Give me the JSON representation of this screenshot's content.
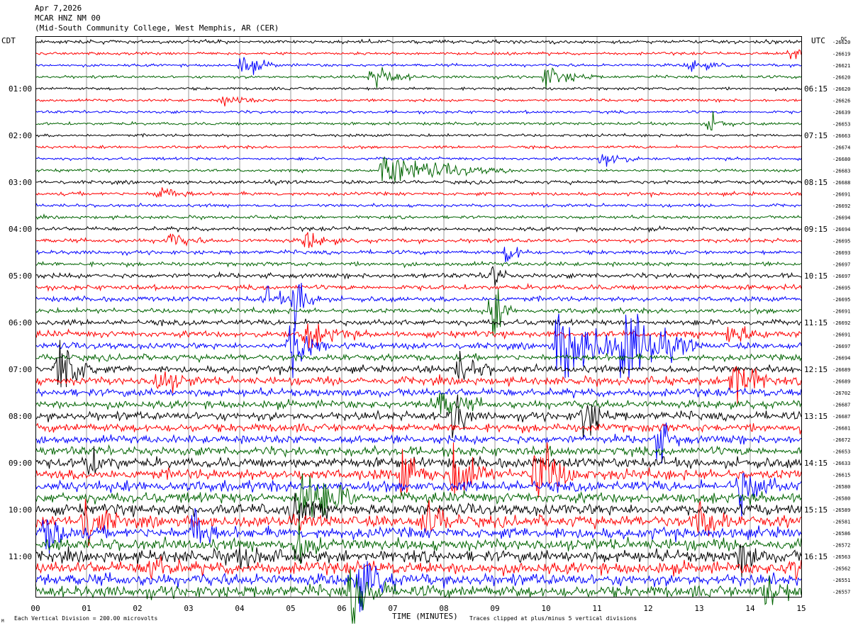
{
  "header": {
    "date": "Apr 7,2026",
    "station": "MCAR HNZ NM 00",
    "location": "(Mid-South Community College, West Memphis, AR (CER)"
  },
  "chart_data": {
    "type": "line",
    "title": "MCAR HNZ NM 00",
    "left_axis_label": "CDT",
    "right_axis_label": "UTC",
    "dc_label": "DC",
    "xlabel": "TIME (MINUTES)",
    "xlim": [
      0,
      15
    ],
    "x_ticks": [
      "00",
      "01",
      "02",
      "03",
      "04",
      "05",
      "06",
      "07",
      "08",
      "09",
      "10",
      "11",
      "12",
      "13",
      "14",
      "15"
    ],
    "left_time_labels": [
      {
        "row": 4,
        "label": "01:00"
      },
      {
        "row": 8,
        "label": "02:00"
      },
      {
        "row": 12,
        "label": "03:00"
      },
      {
        "row": 16,
        "label": "04:00"
      },
      {
        "row": 20,
        "label": "05:00"
      },
      {
        "row": 24,
        "label": "06:00"
      },
      {
        "row": 28,
        "label": "07:00"
      },
      {
        "row": 32,
        "label": "08:00"
      },
      {
        "row": 36,
        "label": "09:00"
      },
      {
        "row": 40,
        "label": "10:00"
      },
      {
        "row": 44,
        "label": "11:00"
      }
    ],
    "right_time_labels": [
      {
        "row": 4,
        "label": "06:15"
      },
      {
        "row": 8,
        "label": "07:15"
      },
      {
        "row": 12,
        "label": "08:15"
      },
      {
        "row": 16,
        "label": "09:15"
      },
      {
        "row": 20,
        "label": "10:15"
      },
      {
        "row": 24,
        "label": "11:15"
      },
      {
        "row": 28,
        "label": "12:15"
      },
      {
        "row": 32,
        "label": "13:15"
      },
      {
        "row": 36,
        "label": "14:15"
      },
      {
        "row": 40,
        "label": "15:15"
      },
      {
        "row": 44,
        "label": "16:15"
      }
    ],
    "dc_offsets": [
      -26620,
      -26619,
      -26621,
      -26620,
      -26620,
      -26626,
      -26639,
      -26653,
      -26663,
      -26674,
      -26680,
      -26683,
      -26688,
      -26691,
      -26692,
      -26694,
      -26694,
      -26695,
      -26693,
      -26697,
      -26697,
      -26695,
      -26695,
      -26691,
      -26692,
      -26691,
      -26697,
      -26694,
      -26689,
      -26689,
      -26702,
      -26687,
      -26687,
      -26681,
      -26672,
      -26653,
      -26633,
      -26615,
      -26580,
      -26580,
      -26589,
      -26581,
      -26586,
      -26572,
      -26563,
      -26562,
      -26551,
      -26557
    ],
    "trace_colors": [
      "#000000",
      "#ff0000",
      "#0000ff",
      "#006400"
    ],
    "num_traces": 48,
    "minutes_per_trace": 15,
    "noise_amplitude_by_row": [
      0.25,
      0.2,
      0.2,
      0.2,
      0.2,
      0.2,
      0.2,
      0.2,
      0.2,
      0.2,
      0.2,
      0.2,
      0.25,
      0.25,
      0.22,
      0.22,
      0.28,
      0.28,
      0.28,
      0.3,
      0.35,
      0.35,
      0.35,
      0.35,
      0.4,
      0.45,
      0.45,
      0.45,
      0.5,
      0.55,
      0.55,
      0.55,
      0.6,
      0.6,
      0.6,
      0.65,
      0.7,
      0.75,
      0.75,
      0.75,
      0.8,
      0.8,
      0.8,
      0.8,
      0.85,
      0.85,
      0.85,
      0.85
    ],
    "events": [
      {
        "row": 1,
        "t": 14.8,
        "amp": 0.6,
        "dur": 0.2
      },
      {
        "row": 2,
        "t": 4.05,
        "amp": 0.9,
        "dur": 0.3
      },
      {
        "row": 2,
        "t": 12.8,
        "amp": 0.6,
        "dur": 0.3
      },
      {
        "row": 3,
        "t": 6.6,
        "amp": 1.0,
        "dur": 0.35
      },
      {
        "row": 3,
        "t": 10.0,
        "amp": 0.9,
        "dur": 0.4
      },
      {
        "row": 5,
        "t": 3.7,
        "amp": 0.5,
        "dur": 0.3
      },
      {
        "row": 7,
        "t": 13.2,
        "amp": 0.9,
        "dur": 0.2
      },
      {
        "row": 10,
        "t": 11.1,
        "amp": 0.9,
        "dur": 0.3
      },
      {
        "row": 11,
        "t": 6.8,
        "amp": 1.3,
        "dur": 1.0
      },
      {
        "row": 13,
        "t": 2.4,
        "amp": 0.7,
        "dur": 0.3
      },
      {
        "row": 17,
        "t": 2.6,
        "amp": 0.7,
        "dur": 0.3
      },
      {
        "row": 17,
        "t": 5.3,
        "amp": 0.7,
        "dur": 0.3
      },
      {
        "row": 18,
        "t": 9.25,
        "amp": 1.0,
        "dur": 0.2
      },
      {
        "row": 20,
        "t": 8.9,
        "amp": 1.6,
        "dur": 0.15
      },
      {
        "row": 22,
        "t": 4.5,
        "amp": 0.8,
        "dur": 0.3
      },
      {
        "row": 23,
        "t": 8.95,
        "amp": 2.8,
        "dur": 0.15
      },
      {
        "row": 22,
        "t": 5.1,
        "amp": 2.5,
        "dur": 0.2
      },
      {
        "row": 25,
        "t": 5.3,
        "amp": 1.2,
        "dur": 0.4
      },
      {
        "row": 25,
        "t": 13.6,
        "amp": 1.0,
        "dur": 0.3
      },
      {
        "row": 26,
        "t": 5.0,
        "amp": 2.4,
        "dur": 0.3
      },
      {
        "row": 26,
        "t": 10.2,
        "amp": 3.0,
        "dur": 0.8
      },
      {
        "row": 26,
        "t": 11.5,
        "amp": 3.2,
        "dur": 0.6
      },
      {
        "row": 28,
        "t": 0.45,
        "amp": 3.0,
        "dur": 0.3
      },
      {
        "row": 28,
        "t": 8.3,
        "amp": 1.2,
        "dur": 0.3
      },
      {
        "row": 29,
        "t": 2.4,
        "amp": 1.2,
        "dur": 0.3
      },
      {
        "row": 29,
        "t": 13.65,
        "amp": 3.0,
        "dur": 0.3
      },
      {
        "row": 31,
        "t": 7.8,
        "amp": 1.4,
        "dur": 0.4
      },
      {
        "row": 32,
        "t": 8.2,
        "amp": 2.6,
        "dur": 0.15
      },
      {
        "row": 32,
        "t": 10.75,
        "amp": 2.6,
        "dur": 0.2
      },
      {
        "row": 34,
        "t": 12.2,
        "amp": 1.8,
        "dur": 0.2
      },
      {
        "row": 36,
        "t": 1.0,
        "amp": 1.2,
        "dur": 0.3
      },
      {
        "row": 37,
        "t": 7.2,
        "amp": 2.5,
        "dur": 0.25
      },
      {
        "row": 37,
        "t": 8.2,
        "amp": 3.0,
        "dur": 0.3
      },
      {
        "row": 37,
        "t": 9.8,
        "amp": 3.3,
        "dur": 0.35
      },
      {
        "row": 38,
        "t": 13.8,
        "amp": 2.2,
        "dur": 0.3
      },
      {
        "row": 39,
        "t": 5.2,
        "amp": 2.6,
        "dur": 0.5
      },
      {
        "row": 40,
        "t": 5.0,
        "amp": 1.5,
        "dur": 0.3
      },
      {
        "row": 41,
        "t": 0.95,
        "amp": 2.3,
        "dur": 0.3
      },
      {
        "row": 41,
        "t": 7.6,
        "amp": 1.8,
        "dur": 0.3
      },
      {
        "row": 41,
        "t": 13.0,
        "amp": 2.2,
        "dur": 0.25
      },
      {
        "row": 42,
        "t": 3.1,
        "amp": 2.4,
        "dur": 0.2
      },
      {
        "row": 42,
        "t": 0.2,
        "amp": 1.6,
        "dur": 0.3
      },
      {
        "row": 43,
        "t": 5.1,
        "amp": 1.8,
        "dur": 0.3
      },
      {
        "row": 44,
        "t": 13.8,
        "amp": 1.6,
        "dur": 0.2
      },
      {
        "row": 44,
        "t": 4.0,
        "amp": 0.9,
        "dur": 0.3
      },
      {
        "row": 45,
        "t": 2.2,
        "amp": 1.2,
        "dur": 0.3
      },
      {
        "row": 45,
        "t": 14.8,
        "amp": 1.3,
        "dur": 0.3
      },
      {
        "row": 46,
        "t": 6.3,
        "amp": 2.6,
        "dur": 0.3
      },
      {
        "row": 47,
        "t": 6.2,
        "amp": 2.8,
        "dur": 0.3
      },
      {
        "row": 47,
        "t": 14.3,
        "amp": 1.2,
        "dur": 0.3
      }
    ]
  },
  "footer": {
    "scale_note": "Each Vertical Division =  200.00 microvolts",
    "clip_note": "Traces clipped at plus/minus 5 vertical divisions",
    "corner_mark": "M"
  }
}
